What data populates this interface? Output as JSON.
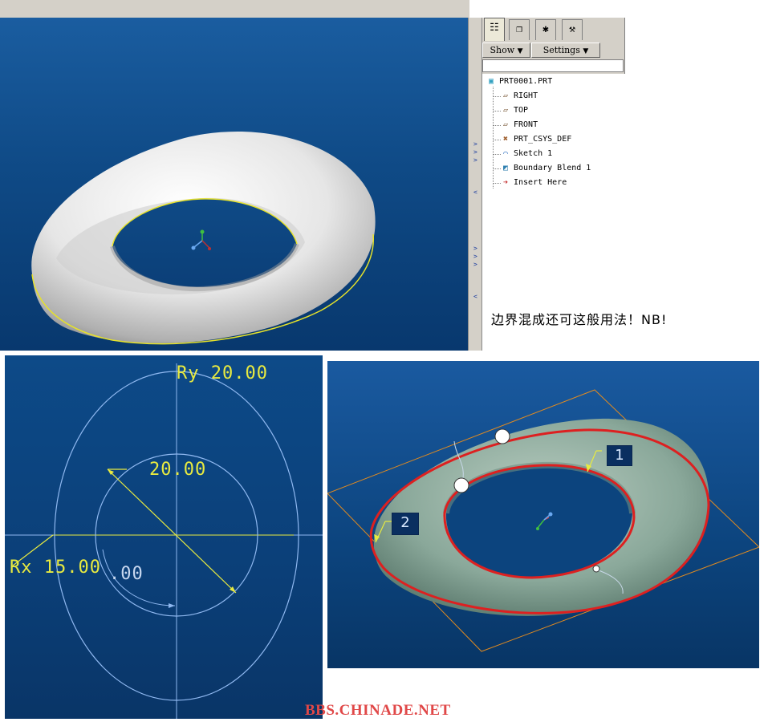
{
  "toolbar_tabs": [
    "model-tree-tab",
    "layers-tab",
    "favorites-tab",
    "connections-tab"
  ],
  "panel": {
    "show_label": "Show",
    "settings_label": "Settings"
  },
  "model_tree": {
    "root": "PRT0001.PRT",
    "items": [
      {
        "label": "RIGHT",
        "icon": "datum-plane-icon"
      },
      {
        "label": "TOP",
        "icon": "datum-plane-icon"
      },
      {
        "label": "FRONT",
        "icon": "datum-plane-icon"
      },
      {
        "label": "PRT_CSYS_DEF",
        "icon": "csys-icon"
      },
      {
        "label": "Sketch 1",
        "icon": "sketch-icon"
      },
      {
        "label": "Boundary Blend 1",
        "icon": "boundary-blend-icon"
      },
      {
        "label": "Insert Here",
        "icon": "insert-arrow-icon"
      }
    ]
  },
  "caption": "边界混成还可这般用法！NB!",
  "sketch": {
    "ry_dim": "Ry 20.00",
    "radius_dim": "20.00",
    "rx_dim": "Rx 15.00",
    "angle_dim": ".00"
  },
  "blend": {
    "label_1": "1",
    "label_2": "2"
  },
  "watermark": "BBS.CHINADE.NET",
  "colors": {
    "viewport_blue": "#0f4a86",
    "curve_red": "#dd2020",
    "dimension_yellow": "#e8ea40",
    "sketch_line": "#8fb8f0"
  }
}
